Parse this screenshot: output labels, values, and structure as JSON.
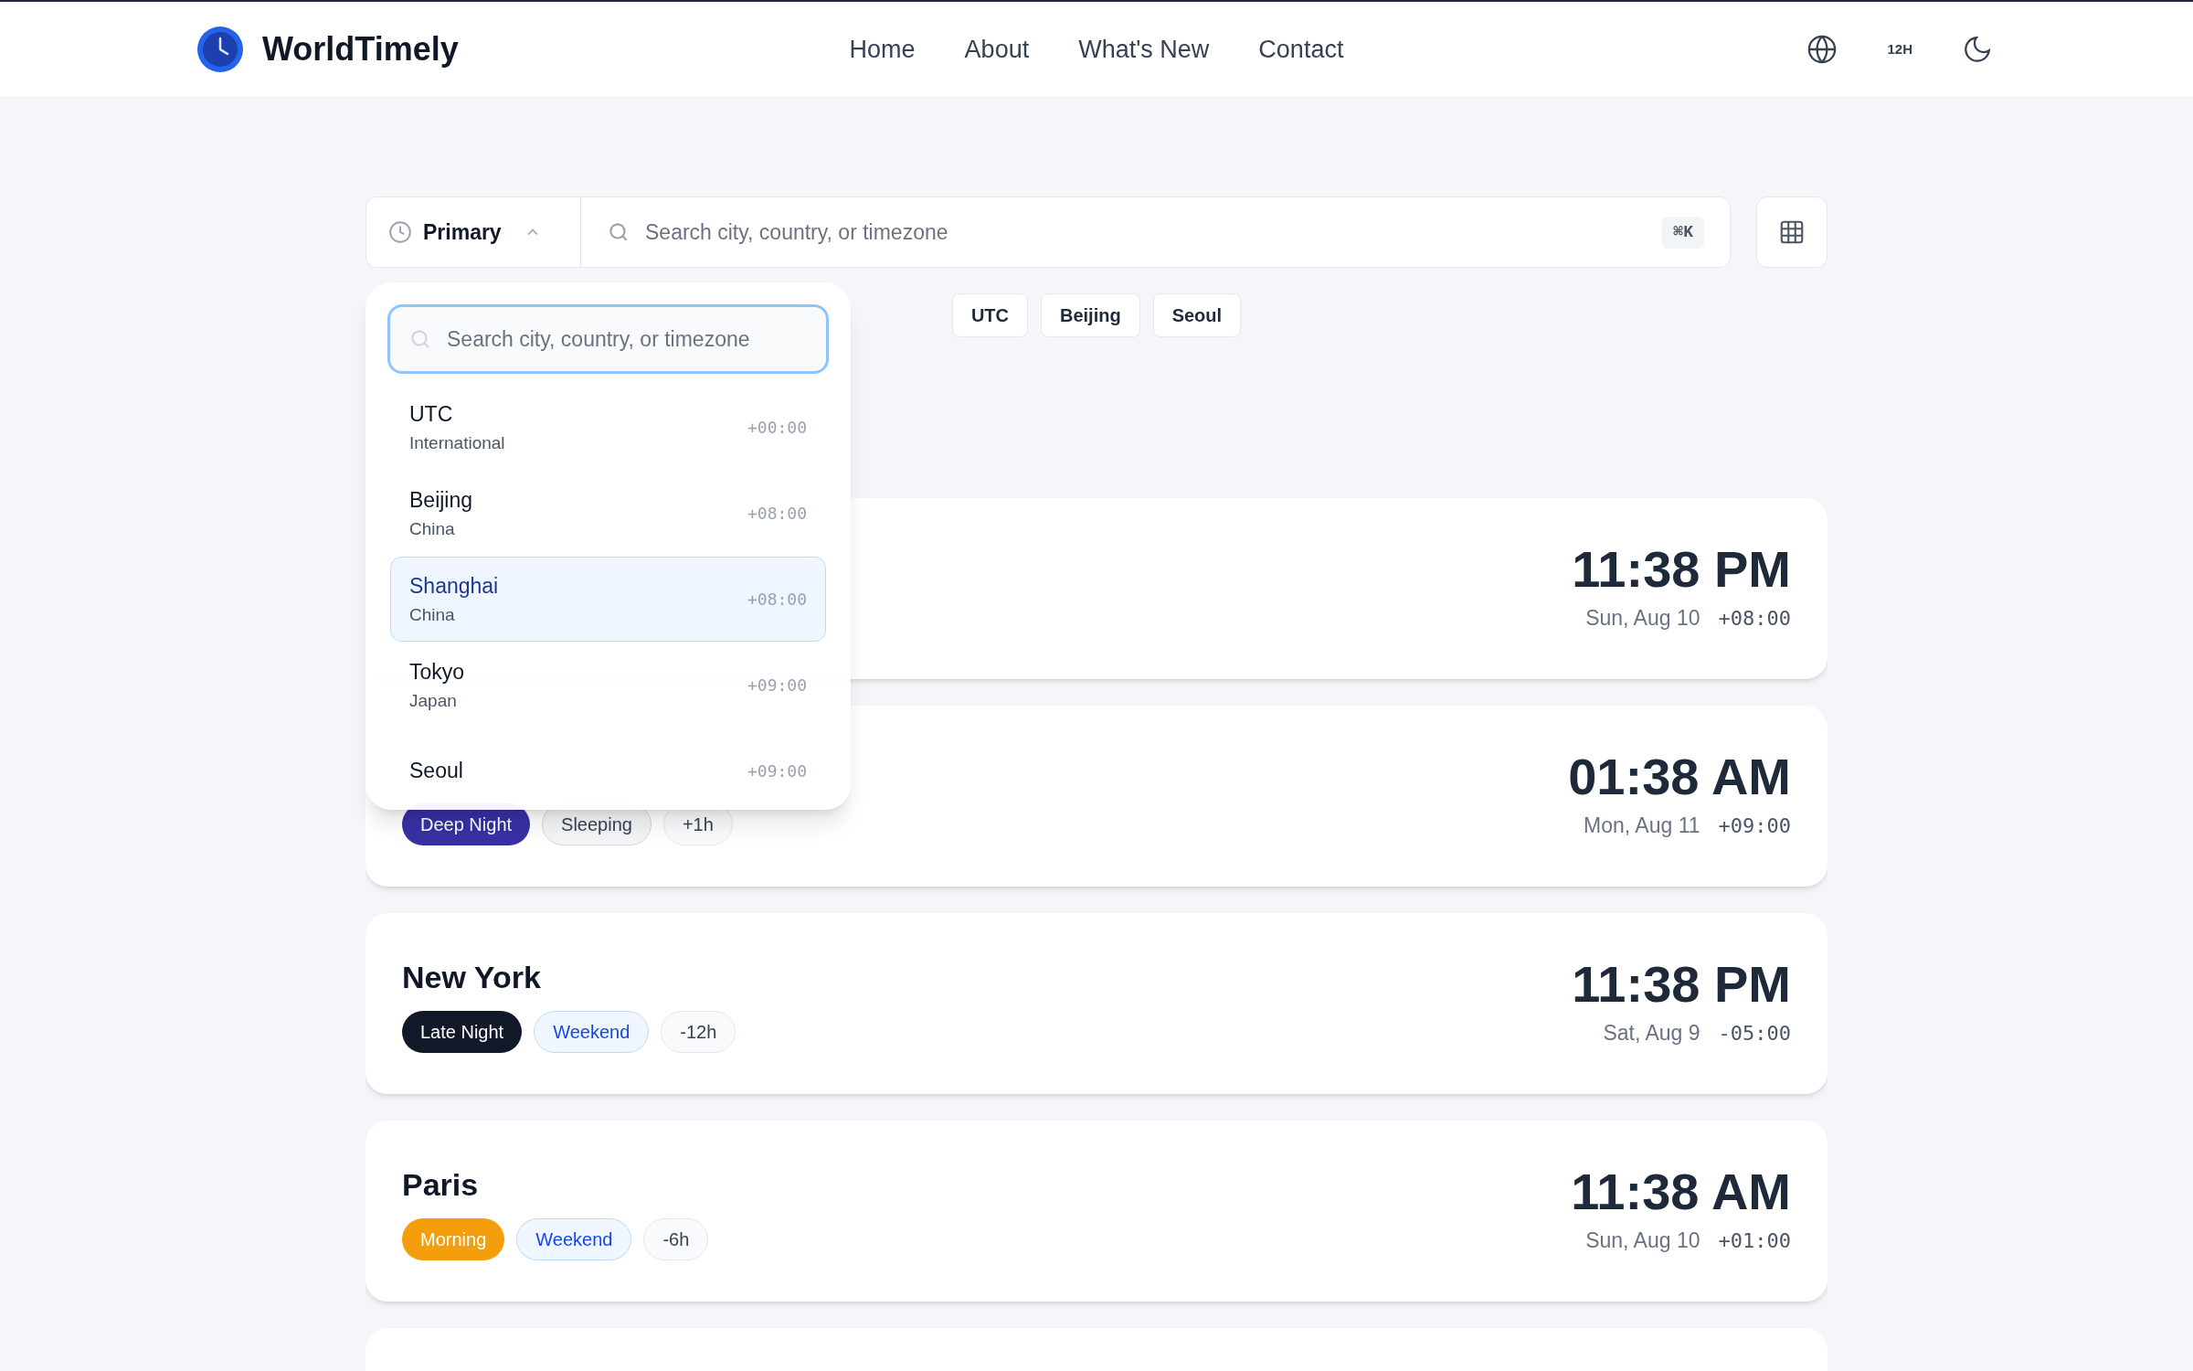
{
  "brand": {
    "name": "WorldTimely"
  },
  "nav": [
    {
      "label": "Home"
    },
    {
      "label": "About"
    },
    {
      "label": "What's New"
    },
    {
      "label": "Contact"
    }
  ],
  "header_actions": {
    "time_format": "12H"
  },
  "search_bar": {
    "mode": "Primary",
    "placeholder": "Search city, country, or timezone",
    "shortcut": "⌘K"
  },
  "dropdown": {
    "placeholder": "Search city, country, or timezone",
    "items": [
      {
        "city": "UTC",
        "region": "International",
        "offset": "+00:00",
        "selected": false
      },
      {
        "city": "Beijing",
        "region": "China",
        "offset": "+08:00",
        "selected": false
      },
      {
        "city": "Shanghai",
        "region": "China",
        "offset": "+08:00",
        "selected": true
      },
      {
        "city": "Tokyo",
        "region": "Japan",
        "offset": "+09:00",
        "selected": false
      },
      {
        "city": "Seoul",
        "offset": "+09:00",
        "selected": false
      }
    ]
  },
  "quick_picks": [
    {
      "label": "UTC"
    },
    {
      "label": "Beijing"
    },
    {
      "label": "Seoul"
    }
  ],
  "cards": [
    {
      "time": "11:38 PM",
      "date": "Sun, Aug 10",
      "offset": "+08:00"
    },
    {
      "time": "01:38 AM",
      "date": "Mon, Aug 11",
      "offset": "+09:00",
      "tags": [
        {
          "label": "Deep Night",
          "kind": "period",
          "color": "#3730a3"
        },
        {
          "label": "Sleeping",
          "kind": "status"
        },
        {
          "label": "+1h",
          "kind": "diff"
        }
      ]
    },
    {
      "city": "New York",
      "time": "11:38 PM",
      "date": "Sat, Aug 9",
      "offset": "-05:00",
      "tags": [
        {
          "label": "Late Night",
          "kind": "period",
          "color": "#111827"
        },
        {
          "label": "Weekend",
          "kind": "weekend"
        },
        {
          "label": "-12h",
          "kind": "diff"
        }
      ]
    },
    {
      "city": "Paris",
      "time": "11:38 AM",
      "date": "Sun, Aug 10",
      "offset": "+01:00",
      "tags": [
        {
          "label": "Morning",
          "kind": "period",
          "color": "#f59e0b"
        },
        {
          "label": "Weekend",
          "kind": "weekend"
        },
        {
          "label": "-6h",
          "kind": "diff"
        }
      ]
    }
  ]
}
